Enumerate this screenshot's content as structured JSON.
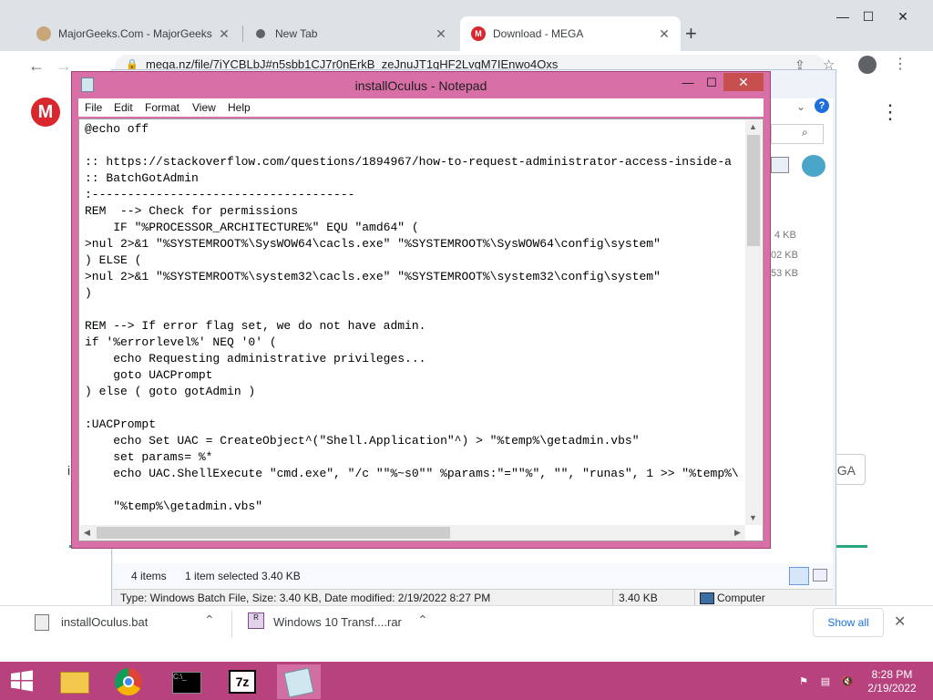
{
  "browser": {
    "tabs": [
      {
        "title": "MajorGeeks.Com - MajorGeeks",
        "favicon": "majorgeeks-icon",
        "active": false
      },
      {
        "title": "New Tab",
        "favicon": "chrome-icon",
        "active": false
      },
      {
        "title": "Download - MEGA",
        "favicon": "mega-icon",
        "active": true
      }
    ],
    "new_tab_label": "+",
    "address_text": "mega.nz/file/7iYCBLbJ#n5sbb1CJ7r0nErkB_zeJnuJT1qHF2LvgM7IEnwo4Oxs",
    "accent": "#1a73e8"
  },
  "mega_page": {
    "logo_letter": "M",
    "sizes": [
      "4 KB",
      "02 KB",
      "53 KB"
    ],
    "button_fragment": "GA",
    "left_fragment": "i"
  },
  "explorer": {
    "status_items": "4 items",
    "status_selected": "1 item selected  3.40 KB",
    "detail_text": "Type: Windows Batch File, Size: 3.40 KB, Date modified: 2/19/2022 8:27 PM",
    "detail_size": "3.40 KB",
    "detail_location": "Computer"
  },
  "notepad": {
    "title": "installOculus - Notepad",
    "menu": [
      "File",
      "Edit",
      "Format",
      "View",
      "Help"
    ],
    "content": "@echo off\n\n:: https://stackoverflow.com/questions/1894967/how-to-request-administrator-access-inside-a\n:: BatchGotAdmin\n:-------------------------------------\nREM  --> Check for permissions\n    IF \"%PROCESSOR_ARCHITECTURE%\" EQU \"amd64\" (\n>nul 2>&1 \"%SYSTEMROOT%\\SysWOW64\\cacls.exe\" \"%SYSTEMROOT%\\SysWOW64\\config\\system\"\n) ELSE (\n>nul 2>&1 \"%SYSTEMROOT%\\system32\\cacls.exe\" \"%SYSTEMROOT%\\system32\\config\\system\"\n)\n\nREM --> If error flag set, we do not have admin.\nif '%errorlevel%' NEQ '0' (\n    echo Requesting administrative privileges...\n    goto UACPrompt\n) else ( goto gotAdmin )\n\n:UACPrompt\n    echo Set UAC = CreateObject^(\"Shell.Application\"^) > \"%temp%\\getadmin.vbs\"\n    set params= %*\n    echo UAC.ShellExecute \"cmd.exe\", \"/c \"\"%~s0\"\" %params:\"=\"\"%\", \"\", \"runas\", 1 >> \"%temp%\\\n\n    \"%temp%\\getadmin.vbs\""
  },
  "downloads": {
    "items": [
      {
        "name": "installOculus.bat",
        "icon": "batch-file-icon"
      },
      {
        "name": "Windows 10 Transf....rar",
        "icon": "rar-file-icon"
      }
    ],
    "show_all_label": "Show all"
  },
  "taskbar": {
    "time": "8:28 PM",
    "date": "2/19/2022",
    "color": "#b7427d",
    "apps": [
      "file-explorer-icon",
      "chrome-icon",
      "command-prompt-icon",
      "7zip-icon",
      "notepad-icon"
    ]
  }
}
